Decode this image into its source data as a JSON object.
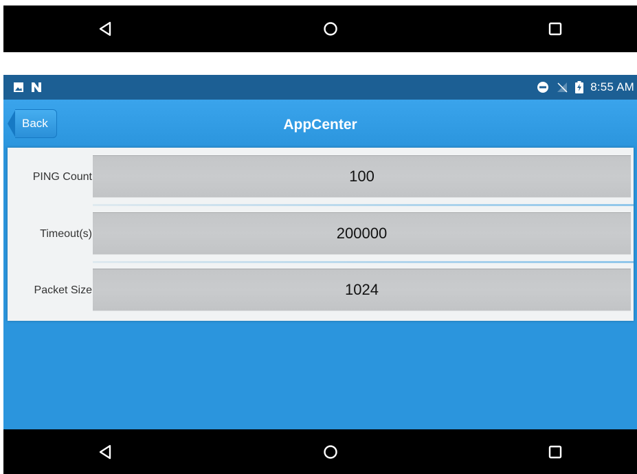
{
  "nav_buttons": {
    "back": "back-triangle",
    "home": "home-circle",
    "recents": "recents-square"
  },
  "status_bar": {
    "left_icons": [
      "image-icon",
      "n-notification-icon"
    ],
    "right_icons": [
      "do-not-disturb-icon",
      "no-signal-icon",
      "battery-charging-icon"
    ],
    "time": "8:55 AM"
  },
  "header": {
    "back_label": "Back",
    "title": "AppCenter"
  },
  "settings": [
    {
      "label": "PING Count",
      "value": "100"
    },
    {
      "label": "Timeout(s)",
      "value": "200000"
    },
    {
      "label": "Packet Size",
      "value": "1024"
    }
  ],
  "colors": {
    "status_bar": "#1c5f94",
    "app_background": "#2b95dd",
    "nav_bar": "#000000",
    "field_background": "#c6c8ca"
  }
}
